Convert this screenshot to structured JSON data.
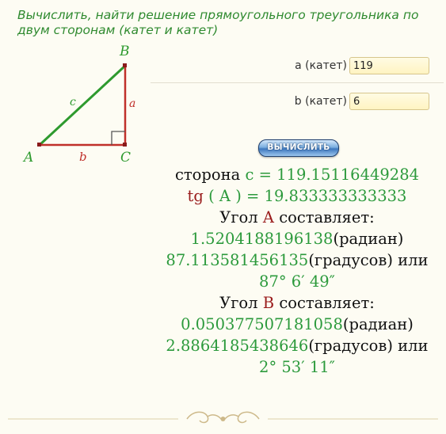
{
  "title": "Вычислить, найти решение прямоугольного треугольника по двум сторонам (катет и катет)",
  "diagram": {
    "vertex_a": "A",
    "vertex_b": "B",
    "vertex_c": "C",
    "side_a": "a",
    "side_b": "b",
    "side_c": "c",
    "colors": {
      "hypotenuse": "#2e9a2e",
      "legs": "#c0302a",
      "labels": "#2e9a2e"
    }
  },
  "form": {
    "a_label": "a (катет)",
    "a_value": "119",
    "b_label": "b (катет)",
    "b_value": "6",
    "button_label": "ВЫЧИСЛИТЬ"
  },
  "results": {
    "side_prefix": "сторона",
    "side_name": "c",
    "side_eq": "=",
    "side_value": "119.15116449284",
    "tg_label": "tg",
    "tg_open": "(",
    "tg_angle": "A",
    "tg_close": ")",
    "tg_eq": "=",
    "tg_value": "19.833333333333",
    "angleA_prefix": "Угол",
    "angleA_name": "A",
    "angleA_suffix": "составляет:",
    "angleA_rad": "1.5204188196138",
    "angleA_rad_unit": "(радиан)",
    "angleA_deg": "87.113581456135",
    "angleA_deg_unit": "(градусов) или",
    "angleA_dms": "87° 6′ 49″",
    "angleB_prefix": "Угол",
    "angleB_name": "B",
    "angleB_suffix": "составляет:",
    "angleB_rad": "0.050377507181058",
    "angleB_rad_unit": "(радиан)",
    "angleB_deg": "2.8864185438646",
    "angleB_deg_unit": "(градусов) или",
    "angleB_dms": "2° 53′ 11″"
  }
}
